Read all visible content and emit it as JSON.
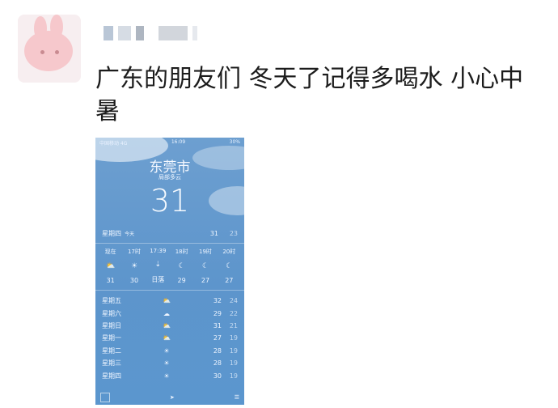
{
  "post": {
    "text": "广东的朋友们 冬天了记得多喝水 小心中暑"
  },
  "weather": {
    "status_left": "中国移动 4G",
    "status_time": "16:09",
    "status_right": "30%",
    "city": "东莞市",
    "condition": "局部多云",
    "temperature": "31",
    "today": {
      "day": "星期四",
      "tag": "今天",
      "high": "31",
      "low": "23"
    },
    "hourly": [
      {
        "time": "现在",
        "icon": "partly-cloudy-icon",
        "glyph": "⛅",
        "temp": "31"
      },
      {
        "time": "17时",
        "icon": "sun-icon",
        "glyph": "☀",
        "temp": "30"
      },
      {
        "time": "17:39",
        "icon": "sunset-icon",
        "glyph": "⇣",
        "temp": "日落"
      },
      {
        "time": "18时",
        "icon": "moon-icon",
        "glyph": "☾",
        "temp": "29"
      },
      {
        "time": "19时",
        "icon": "moon-icon",
        "glyph": "☾",
        "temp": "27"
      },
      {
        "time": "20时",
        "icon": "moon-icon",
        "glyph": "☾",
        "temp": "27"
      }
    ],
    "daily": [
      {
        "day": "星期五",
        "icon": "partly-cloudy-icon",
        "glyph": "⛅",
        "high": "32",
        "low": "24"
      },
      {
        "day": "星期六",
        "icon": "cloud-icon",
        "glyph": "☁",
        "high": "29",
        "low": "22"
      },
      {
        "day": "星期日",
        "icon": "partly-cloudy-icon",
        "glyph": "⛅",
        "high": "31",
        "low": "21"
      },
      {
        "day": "星期一",
        "icon": "partly-cloudy-icon",
        "glyph": "⛅",
        "high": "27",
        "low": "19"
      },
      {
        "day": "星期二",
        "icon": "sun-icon",
        "glyph": "☀",
        "high": "28",
        "low": "19"
      },
      {
        "day": "星期三",
        "icon": "sun-icon",
        "glyph": "☀",
        "high": "28",
        "low": "19"
      },
      {
        "day": "星期四",
        "icon": "sun-icon",
        "glyph": "☀",
        "high": "30",
        "low": "19"
      }
    ]
  }
}
